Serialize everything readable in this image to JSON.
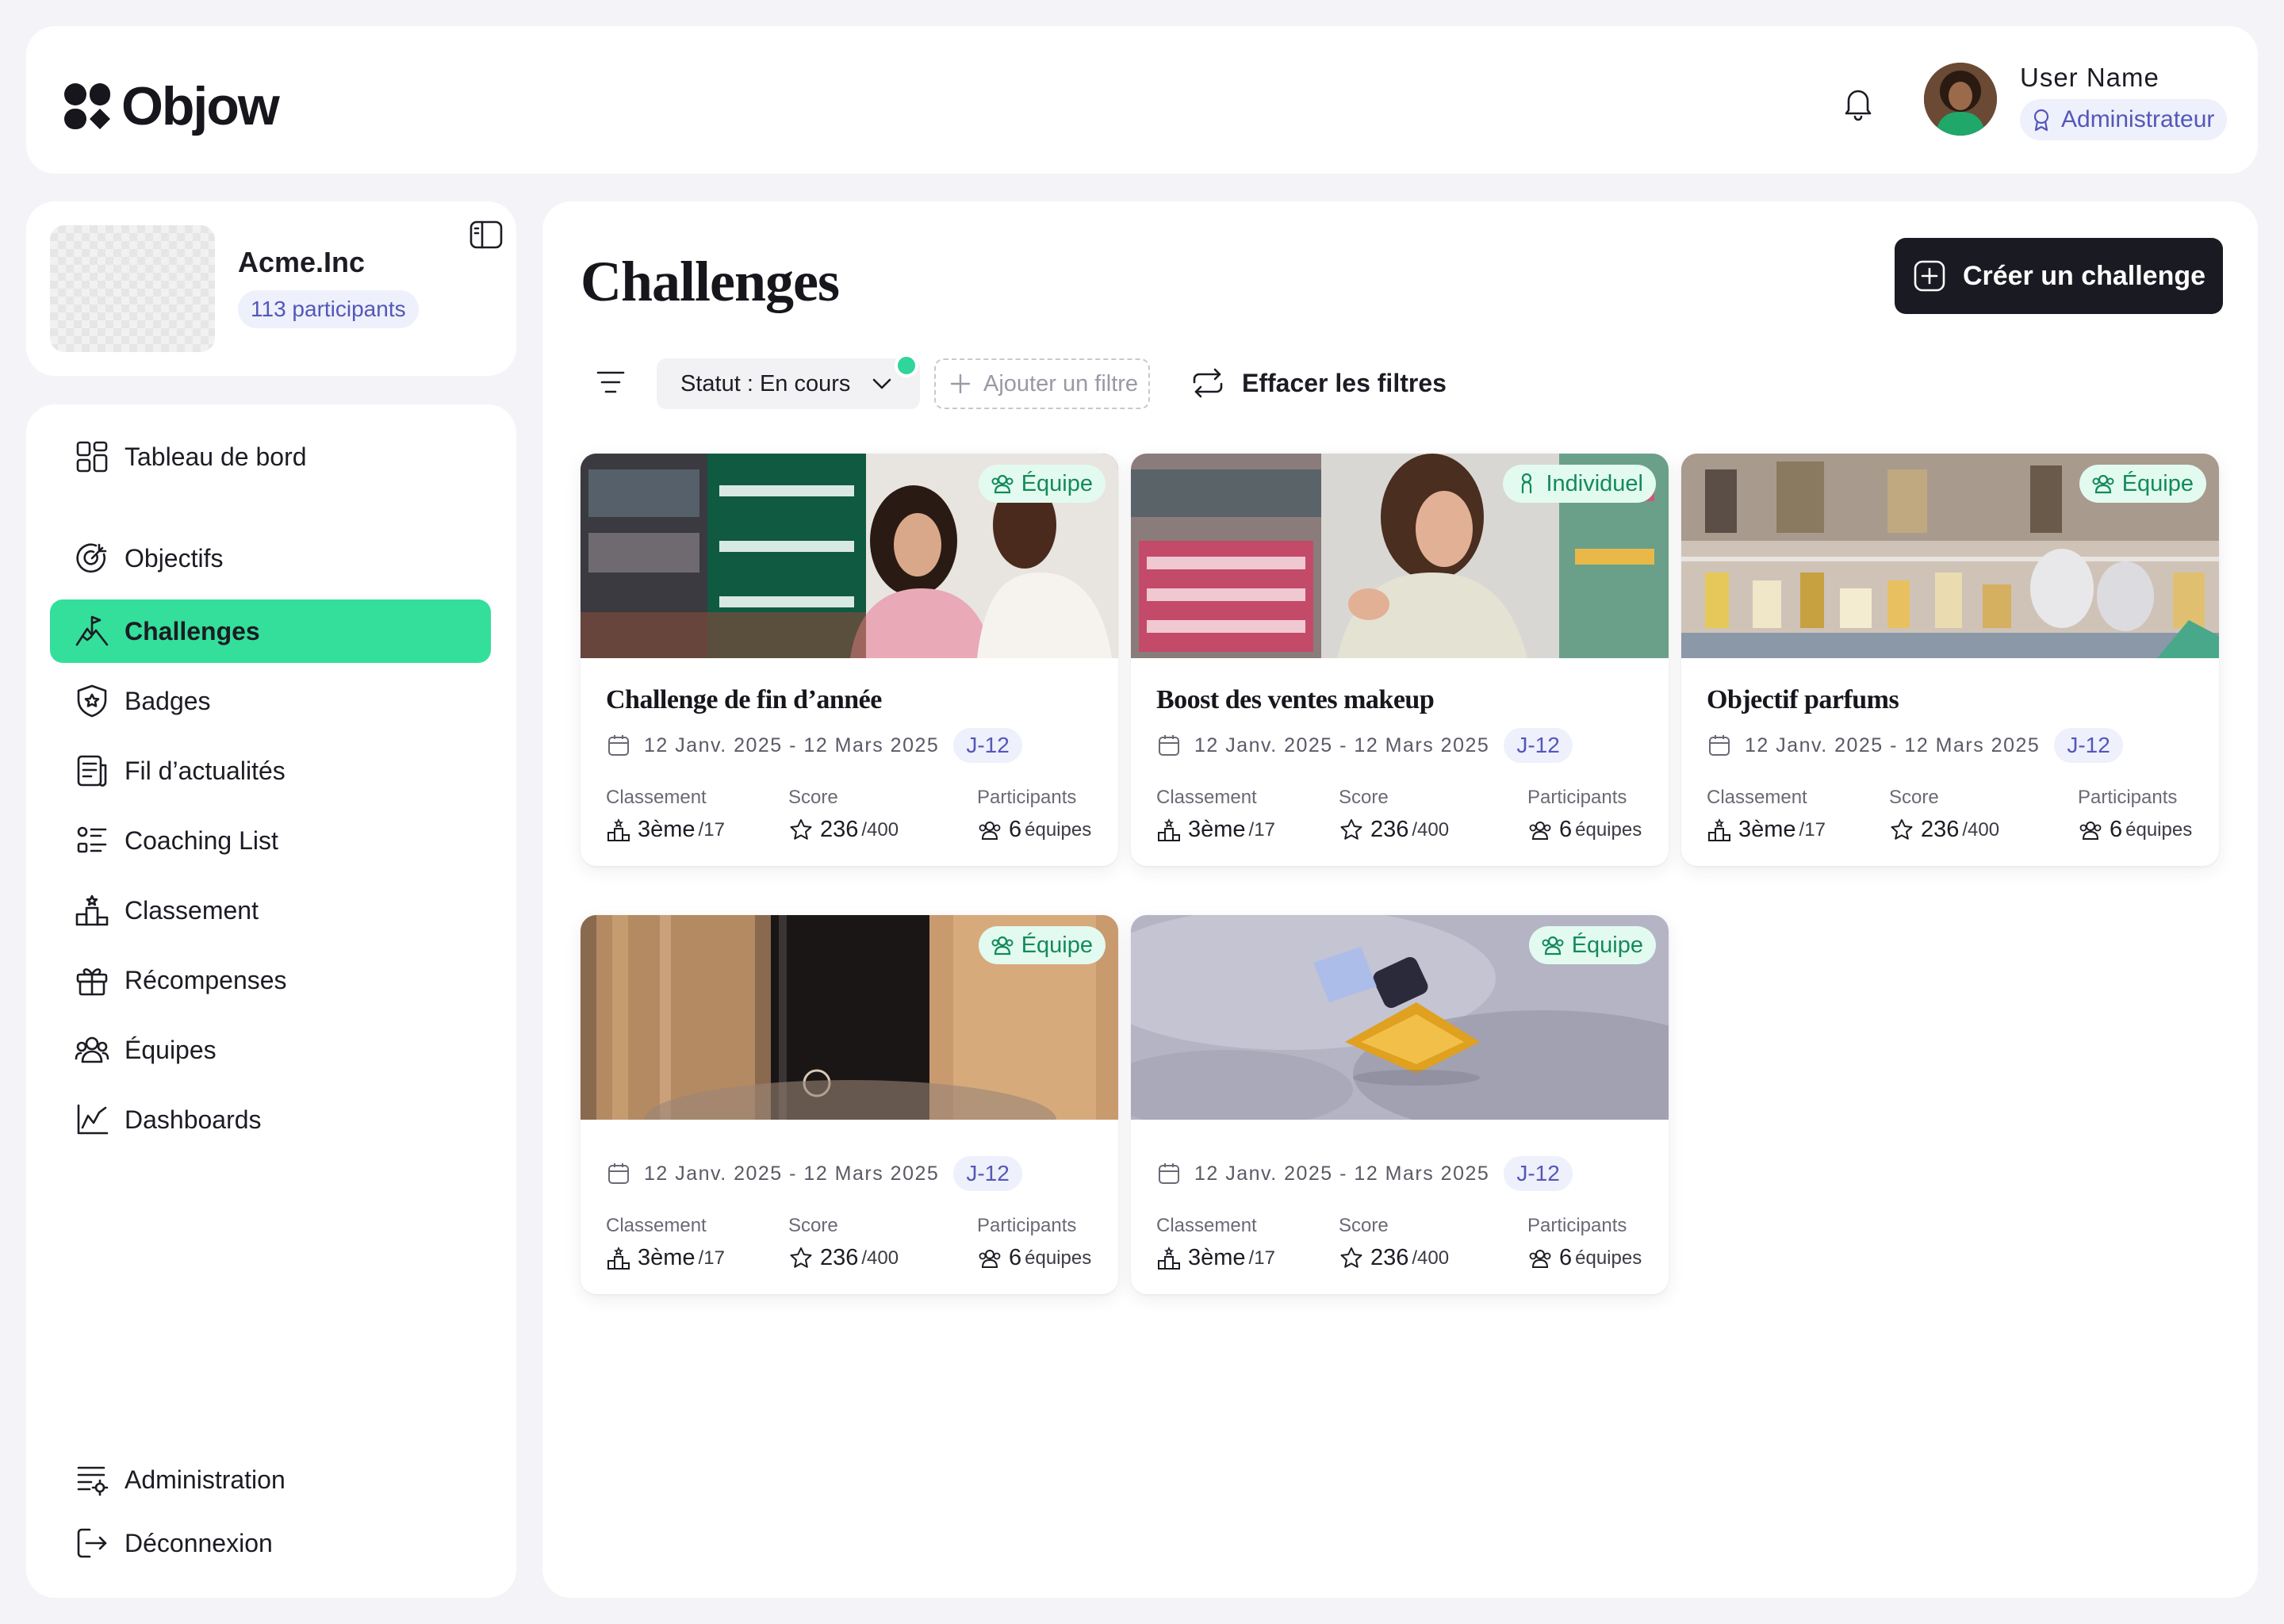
{
  "app": {
    "name": "Objow"
  },
  "user": {
    "name": "User Name",
    "role": "Administrateur"
  },
  "company": {
    "name": "Acme.Inc",
    "participants": "113 participants"
  },
  "nav": {
    "items": [
      {
        "label": "Tableau de bord",
        "icon": "dashboard-grid-icon"
      },
      {
        "label": "Objectifs",
        "icon": "target-icon"
      },
      {
        "label": "Challenges",
        "icon": "mountain-flag-icon",
        "active": true
      },
      {
        "label": "Badges",
        "icon": "badge-shield-icon"
      },
      {
        "label": "Fil d’actualités",
        "icon": "newsfeed-icon"
      },
      {
        "label": "Coaching List",
        "icon": "checklist-icon"
      },
      {
        "label": "Classement",
        "icon": "podium-icon"
      },
      {
        "label": "Récompenses",
        "icon": "gift-icon"
      },
      {
        "label": "Équipes",
        "icon": "team-icon"
      },
      {
        "label": "Dashboards",
        "icon": "line-chart-icon"
      }
    ],
    "bottom": [
      {
        "label": "Administration",
        "icon": "admin-settings-icon"
      },
      {
        "label": "Déconnexion",
        "icon": "logout-icon"
      }
    ]
  },
  "page": {
    "title": "Challenges",
    "create_label": "Créer un challenge",
    "filter_status": "Statut : En cours",
    "add_filter": "Ajouter un filtre",
    "clear_filters": "Effacer les filtres"
  },
  "labels": {
    "ranking": "Classement",
    "score": "Score",
    "participants": "Participants"
  },
  "challenges": [
    {
      "title": "Challenge de fin d’année",
      "type": "Équipe",
      "dates": "12 Janv. 2025 - 12 Mars 2025",
      "countdown": "J-12",
      "rank": "3ème",
      "rank_total": "/17",
      "score": "236",
      "score_max": "/400",
      "teams": "6",
      "teams_label": "équipes"
    },
    {
      "title": "Boost des ventes makeup",
      "type": "Individuel",
      "dates": "12 Janv. 2025 - 12 Mars 2025",
      "countdown": "J-12",
      "rank": "3ème",
      "rank_total": "/17",
      "score": "236",
      "score_max": "/400",
      "teams": "6",
      "teams_label": "équipes"
    },
    {
      "title": "Objectif parfums",
      "type": "Équipe",
      "dates": "12 Janv. 2025 - 12 Mars 2025",
      "countdown": "J-12",
      "rank": "3ème",
      "rank_total": "/17",
      "score": "236",
      "score_max": "/400",
      "teams": "6",
      "teams_label": "équipes"
    },
    {
      "title": "",
      "type": "Équipe",
      "dates": "12 Janv. 2025 - 12 Mars 2025",
      "countdown": "J-12",
      "rank": "3ème",
      "rank_total": "/17",
      "score": "236",
      "score_max": "/400",
      "teams": "6",
      "teams_label": "équipes"
    },
    {
      "title": "",
      "type": "Équipe",
      "dates": "12 Janv. 2025 - 12 Mars 2025",
      "countdown": "J-12",
      "rank": "3ème",
      "rank_total": "/17",
      "score": "236",
      "score_max": "/400",
      "teams": "6",
      "teams_label": "équipes"
    }
  ],
  "colors": {
    "accent": "#33df9a",
    "chip_bg": "#eef0fb",
    "chip_text": "#5457b8",
    "badge_bg": "#e3faf0",
    "badge_text": "#138a5c",
    "button_dark": "#1a1a22"
  }
}
